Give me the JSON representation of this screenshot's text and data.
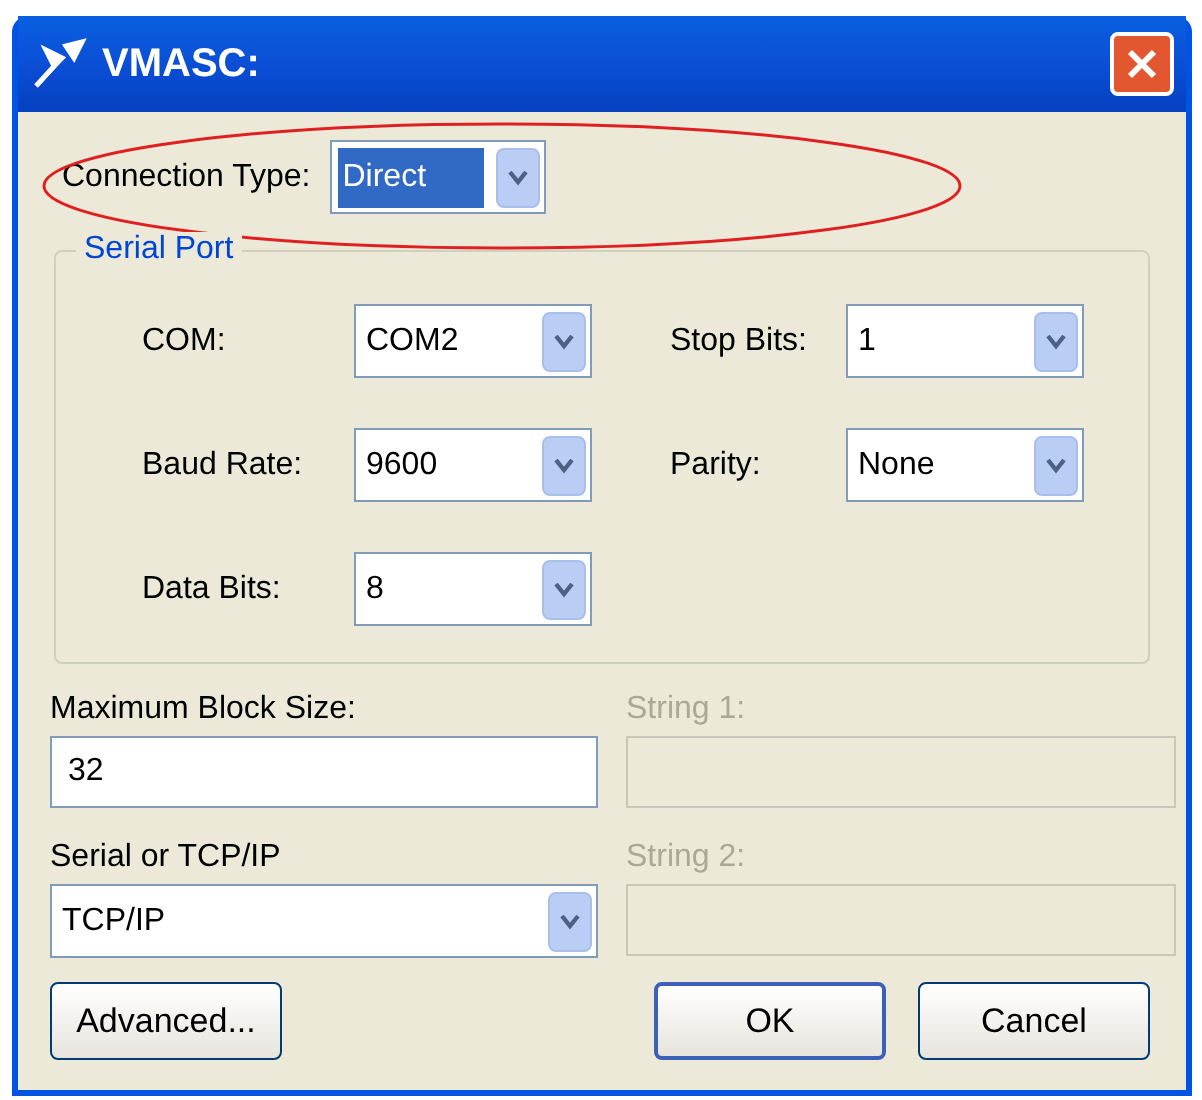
{
  "window": {
    "title": "VMASC:"
  },
  "connection_type": {
    "label": "Connection Type:",
    "value": "Direct",
    "highlighted": true,
    "circled": true
  },
  "serial_port": {
    "title": "Serial Port",
    "fields": [
      {
        "label": "COM:",
        "value": "COM2"
      },
      {
        "label": "Stop Bits:",
        "value": "1"
      },
      {
        "label": "Baud Rate:",
        "value": "9600"
      },
      {
        "label": "Parity:",
        "value": "None"
      },
      {
        "label": "Data Bits:",
        "value": "8"
      }
    ]
  },
  "max_block_size": {
    "label": "Maximum Block Size:",
    "value": "32"
  },
  "string_1": {
    "label": "String 1:",
    "disabled": true
  },
  "serial_or_tcpip": {
    "label": "Serial or TCP/IP",
    "value": "TCP/IP"
  },
  "string_2": {
    "label": "String 2:",
    "disabled": true
  },
  "buttons": [
    {
      "label": "Advanced...",
      "default": false
    },
    {
      "label": "OK",
      "default": true
    },
    {
      "label": "Cancel",
      "default": false
    }
  ]
}
